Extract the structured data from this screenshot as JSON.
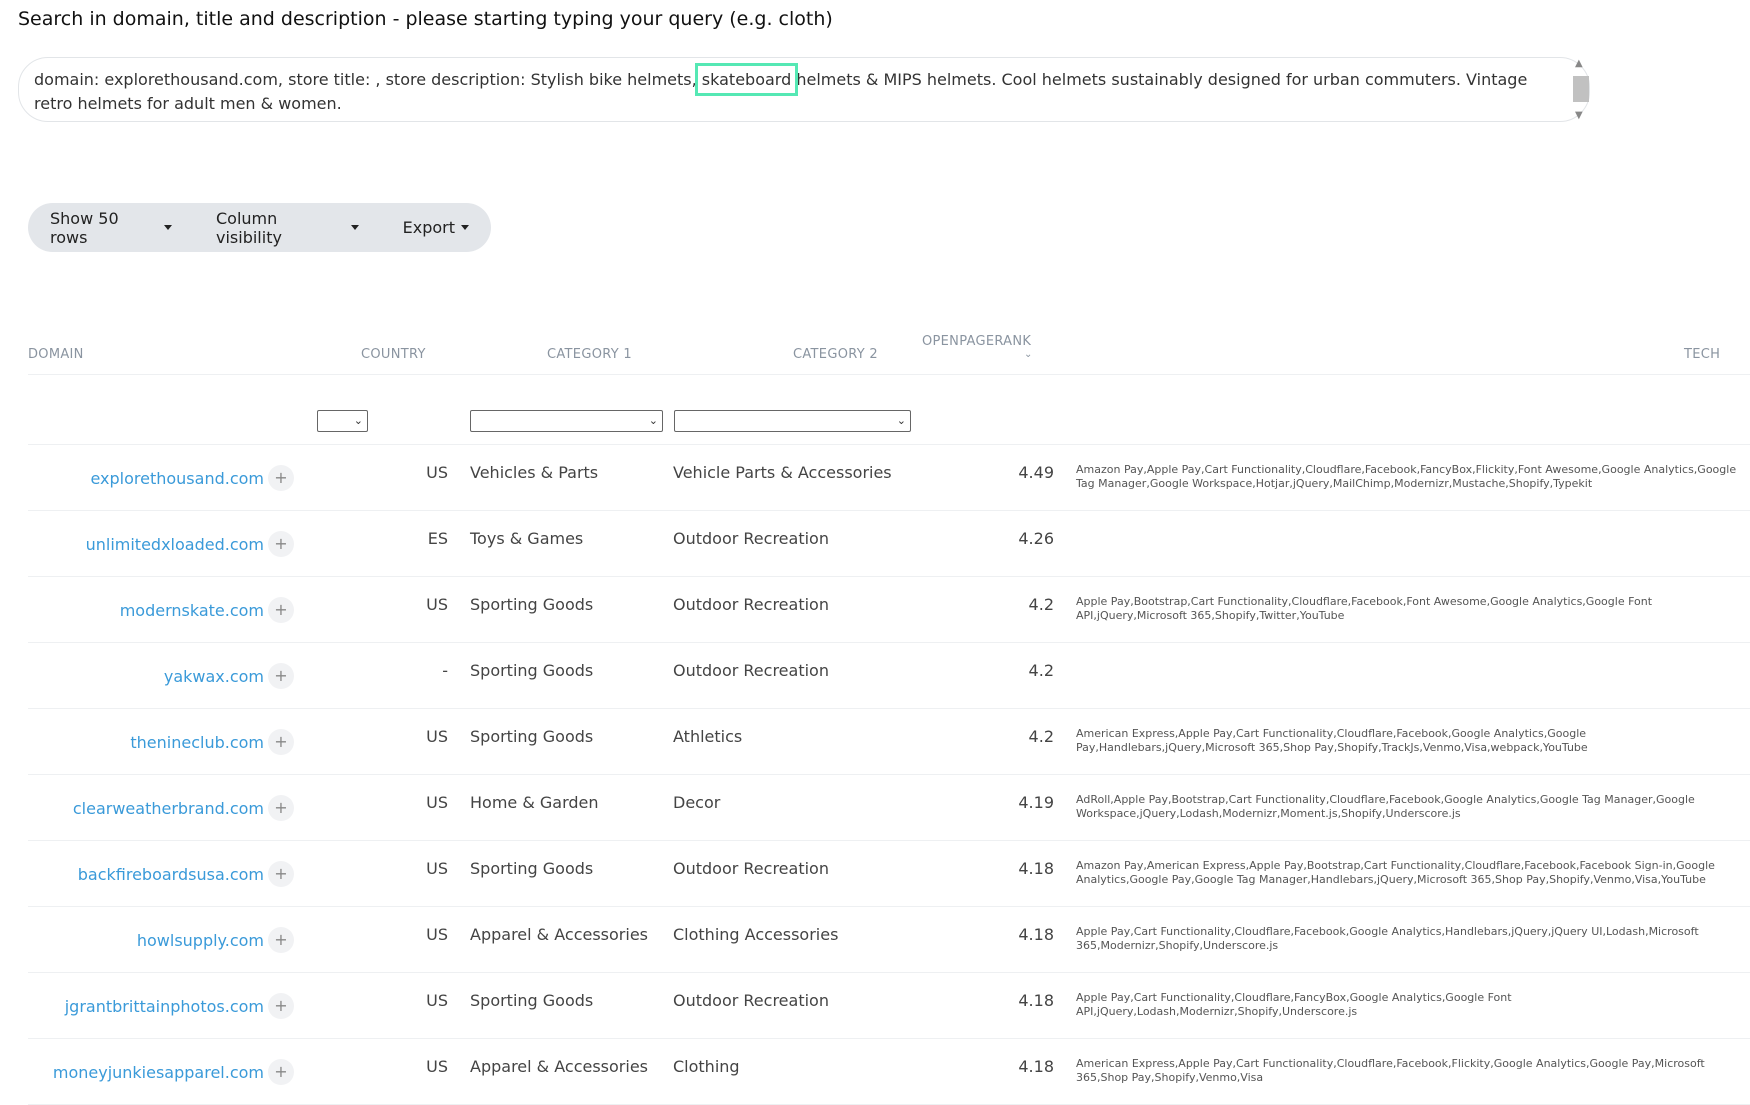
{
  "search": {
    "title": "Search in domain, title and description - please starting typing your query (e.g. cloth)",
    "text_before": "domain: explorethousand.com, store title: , store description: Stylish bike helmets, ",
    "text_highlight": "skateboard",
    "text_after": " helmets & MIPS helmets. Cool helmets sustainably designed for urban commuters. Vintage retro helmets for adult men & women."
  },
  "toolbar": {
    "rows_label": "Show 50 rows",
    "columns_label": "Column visibility",
    "export_label": "Export"
  },
  "columns": {
    "domain": "DOMAIN",
    "country": "COUNTRY",
    "category1": "CATEGORY 1",
    "category2": "CATEGORY 2",
    "openpagerank": "OPENPAGERANK",
    "tech": "TECH"
  },
  "rows": [
    {
      "domain": "explorethousand.com",
      "country": "US",
      "cat1": "Vehicles & Parts",
      "cat2": "Vehicle Parts & Accessories",
      "opr": "4.49",
      "tech": "Amazon Pay,Apple Pay,Cart Functionality,Cloudflare,Facebook,FancyBox,Flickity,Font Awesome,Google Analytics,Google Tag Manager,Google Workspace,Hotjar,jQuery,MailChimp,Modernizr,Mustache,Shopify,Typekit"
    },
    {
      "domain": "unlimitedxloaded.com",
      "country": "ES",
      "cat1": "Toys & Games",
      "cat2": "Outdoor Recreation",
      "opr": "4.26",
      "tech": ""
    },
    {
      "domain": "modernskate.com",
      "country": "US",
      "cat1": "Sporting Goods",
      "cat2": "Outdoor Recreation",
      "opr": "4.2",
      "tech": "Apple Pay,Bootstrap,Cart Functionality,Cloudflare,Facebook,Font Awesome,Google Analytics,Google Font API,jQuery,Microsoft 365,Shopify,Twitter,YouTube"
    },
    {
      "domain": "yakwax.com",
      "country": "-",
      "cat1": "Sporting Goods",
      "cat2": "Outdoor Recreation",
      "opr": "4.2",
      "tech": ""
    },
    {
      "domain": "thenineclub.com",
      "country": "US",
      "cat1": "Sporting Goods",
      "cat2": "Athletics",
      "opr": "4.2",
      "tech": "American Express,Apple Pay,Cart Functionality,Cloudflare,Facebook,Google Analytics,Google Pay,Handlebars,jQuery,Microsoft 365,Shop Pay,Shopify,TrackJs,Venmo,Visa,webpack,YouTube"
    },
    {
      "domain": "clearweatherbrand.com",
      "country": "US",
      "cat1": "Home & Garden",
      "cat2": "Decor",
      "opr": "4.19",
      "tech": "AdRoll,Apple Pay,Bootstrap,Cart Functionality,Cloudflare,Facebook,Google Analytics,Google Tag Manager,Google Workspace,jQuery,Lodash,Modernizr,Moment.js,Shopify,Underscore.js"
    },
    {
      "domain": "backfireboardsusa.com",
      "country": "US",
      "cat1": "Sporting Goods",
      "cat2": "Outdoor Recreation",
      "opr": "4.18",
      "tech": "Amazon Pay,American Express,Apple Pay,Bootstrap,Cart Functionality,Cloudflare,Facebook,Facebook Sign-in,Google Analytics,Google Pay,Google Tag Manager,Handlebars,jQuery,Microsoft 365,Shop Pay,Shopify,Venmo,Visa,YouTube"
    },
    {
      "domain": "howlsupply.com",
      "country": "US",
      "cat1": "Apparel & Accessories",
      "cat2": "Clothing Accessories",
      "opr": "4.18",
      "tech": "Apple Pay,Cart Functionality,Cloudflare,Facebook,Google Analytics,Handlebars,jQuery,jQuery UI,Lodash,Microsoft 365,Modernizr,Shopify,Underscore.js"
    },
    {
      "domain": "jgrantbrittainphotos.com",
      "country": "US",
      "cat1": "Sporting Goods",
      "cat2": "Outdoor Recreation",
      "opr": "4.18",
      "tech": "Apple Pay,Cart Functionality,Cloudflare,FancyBox,Google Analytics,Google Font API,jQuery,Lodash,Modernizr,Shopify,Underscore.js"
    },
    {
      "domain": "moneyjunkiesapparel.com",
      "country": "US",
      "cat1": "Apparel & Accessories",
      "cat2": "Clothing",
      "opr": "4.18",
      "tech": "American Express,Apple Pay,Cart Functionality,Cloudflare,Facebook,Flickity,Google Analytics,Google Pay,Microsoft 365,Shop Pay,Shopify,Venmo,Visa"
    }
  ],
  "icons": {
    "plus": "+",
    "chevron": "⌄"
  }
}
